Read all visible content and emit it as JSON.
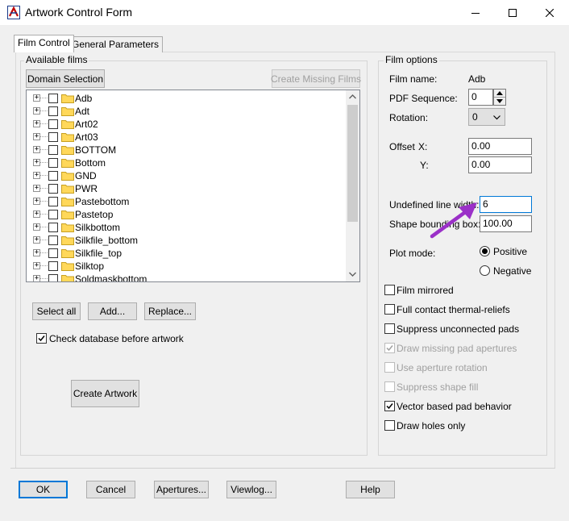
{
  "window": {
    "title": "Artwork Control Form",
    "controls": {
      "minimize_icon": "minimize-icon",
      "maximize_icon": "maximize-icon",
      "close_icon": "close-icon"
    }
  },
  "tabs": [
    {
      "label": "Film Control",
      "active": true
    },
    {
      "label": "General Parameters",
      "active": false
    }
  ],
  "available_films": {
    "group_label": "Available films",
    "domain_selection_label": "Domain Selection",
    "create_missing_films_label": "Create Missing Films",
    "films": [
      "Adb",
      "Adt",
      "Art02",
      "Art03",
      "BOTTOM",
      "Bottom",
      "GND",
      "PWR",
      "Pastebottom",
      "Pastetop",
      "Silkbottom",
      "Silkfile_bottom",
      "Silkfile_top",
      "Silktop",
      "Soldmaskbottom"
    ],
    "select_all_label": "Select all",
    "add_label": "Add...",
    "replace_label": "Replace...",
    "check_database_label": "Check database before artwork",
    "check_database_checked": true,
    "create_artwork_label": "Create Artwork"
  },
  "film_options": {
    "group_label": "Film options",
    "film_name_label": "Film name:",
    "film_name_value": "Adb",
    "pdf_sequence_label": "PDF Sequence:",
    "pdf_sequence_value": "0",
    "rotation_label": "Rotation:",
    "rotation_value": "0",
    "offset_label": "Offset",
    "offset_x_label": "X:",
    "offset_x_value": "0.00",
    "offset_y_label": "Y:",
    "offset_y_value": "0.00",
    "undefined_line_width_label": "Undefined line width:",
    "undefined_line_width_value": "6",
    "shape_bounding_box_label": "Shape bounding box:",
    "shape_bounding_box_value": "100.00",
    "plot_mode_label": "Plot mode:",
    "plot_mode_positive_label": "Positive",
    "plot_mode_negative_label": "Negative",
    "plot_mode_selected": "Positive",
    "checkboxes": [
      {
        "label": "Film mirrored",
        "checked": false,
        "enabled": true
      },
      {
        "label": "Full contact thermal-reliefs",
        "checked": false,
        "enabled": true
      },
      {
        "label": "Suppress unconnected pads",
        "checked": false,
        "enabled": true
      },
      {
        "label": "Draw missing pad apertures",
        "checked": true,
        "enabled": false
      },
      {
        "label": "Use aperture rotation",
        "checked": false,
        "enabled": false
      },
      {
        "label": "Suppress shape fill",
        "checked": false,
        "enabled": false
      },
      {
        "label": "Vector based pad behavior",
        "checked": true,
        "enabled": true
      },
      {
        "label": "Draw holes only",
        "checked": false,
        "enabled": true
      }
    ]
  },
  "footer": {
    "ok_label": "OK",
    "cancel_label": "Cancel",
    "apertures_label": "Apertures...",
    "viewlog_label": "Viewlog...",
    "help_label": "Help"
  },
  "annotation_color": "#9b30c8"
}
